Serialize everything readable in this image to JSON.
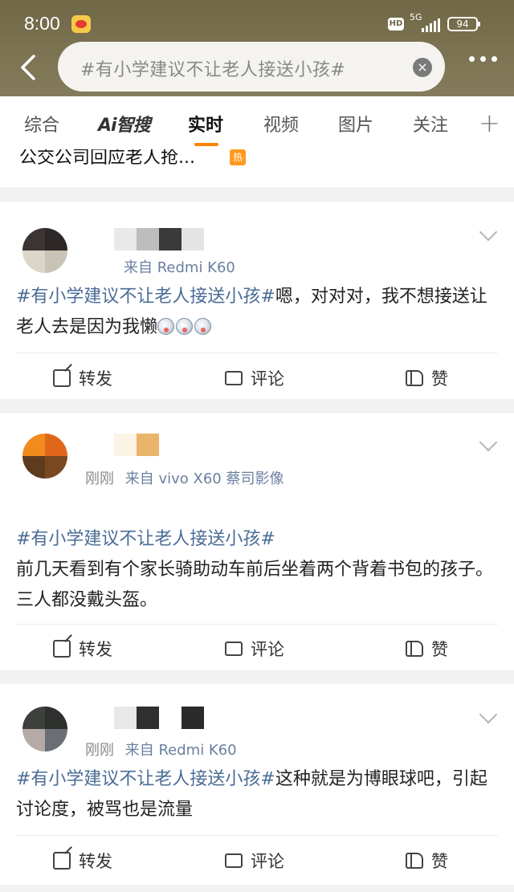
{
  "status_bar": {
    "time": "8:00",
    "network": "5G",
    "battery": "94"
  },
  "search": {
    "query": "#有小学建议不让老人接送小孩#"
  },
  "tabs": [
    {
      "label": "综合"
    },
    {
      "label": "Ai智搜"
    },
    {
      "label": "实时"
    },
    {
      "label": "视频"
    },
    {
      "label": "图片"
    },
    {
      "label": "关注"
    }
  ],
  "add_tab": "+",
  "previous_post": {
    "snippet": "公交公司回应老人抢...",
    "badge": "热"
  },
  "posts": [
    {
      "meta_time": "",
      "meta_source": "来自 Redmi K60",
      "hashtag": "#有小学建议不让老人接送小孩#",
      "text": "嗯，对对对，我不想接送让老人去是因为我懒",
      "actions": {
        "repost": "转发",
        "comment": "评论",
        "like": "赞"
      }
    },
    {
      "meta_time": "刚刚",
      "meta_source": "来自 vivo X60 蔡司影像",
      "hashtag": "#有小学建议不让老人接送小孩#",
      "text": "前几天看到有个家长骑助动车前后坐着两个背着书包的孩子。\n三人都没戴头盔。",
      "actions": {
        "repost": "转发",
        "comment": "评论",
        "like": "赞"
      }
    },
    {
      "meta_time": "刚刚",
      "meta_source": "来自 Redmi K60",
      "hashtag": "#有小学建议不让老人接送小孩#",
      "text": "这种就是为博眼球吧，引起讨论度，被骂也是流量",
      "actions": {
        "repost": "转发",
        "comment": "评论",
        "like": "赞"
      }
    }
  ]
}
